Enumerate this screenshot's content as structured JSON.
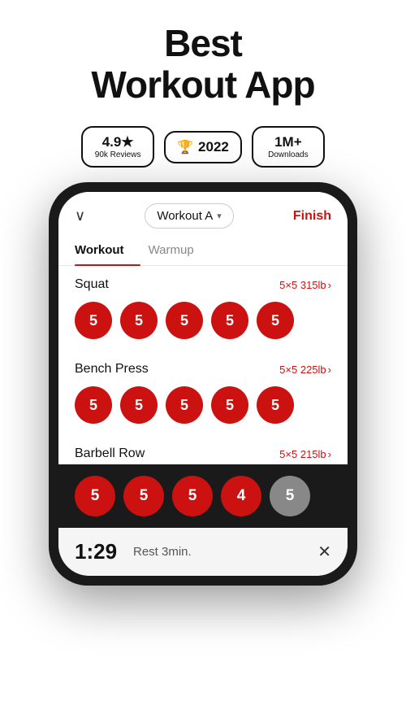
{
  "header": {
    "title_line1": "Best",
    "title_line2": "Workout App"
  },
  "badges": [
    {
      "id": "rating",
      "main": "4.9★",
      "sub": "90k Reviews"
    },
    {
      "id": "award",
      "main": "🏆 2022",
      "sub": ""
    },
    {
      "id": "downloads",
      "main": "1M+",
      "sub": "Downloads"
    }
  ],
  "phone": {
    "topbar": {
      "chevron": "∨",
      "workout_name": "Workout A",
      "caret": "▾",
      "finish": "Finish"
    },
    "tabs": [
      {
        "label": "Workout",
        "active": true
      },
      {
        "label": "Warmup",
        "active": false
      }
    ],
    "exercises": [
      {
        "name": "Squat",
        "sets_label": "5×5 315lb",
        "sets": [
          5,
          5,
          5,
          5,
          5
        ],
        "gray_index": -1
      },
      {
        "name": "Bench Press",
        "sets_label": "5×5 225lb",
        "sets": [
          5,
          5,
          5,
          5,
          5
        ],
        "gray_index": -1
      },
      {
        "name": "Barbell Row",
        "sets_label": "5×5 215lb",
        "sets": [],
        "gray_index": -1
      }
    ],
    "bottom_sets": [
      5,
      5,
      5,
      4,
      5
    ],
    "bottom_gray_last": true,
    "rest_timer": {
      "time": "1:29",
      "label": "Rest 3min.",
      "close": "✕"
    }
  }
}
